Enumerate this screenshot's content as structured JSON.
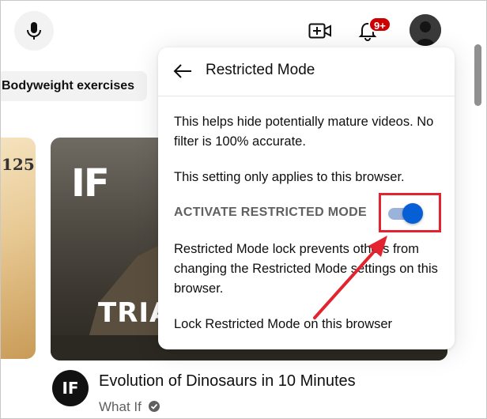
{
  "header": {
    "mic_icon": "microphone-icon",
    "create_icon": "video-create-icon",
    "bell_icon": "bell-icon",
    "notification_count": "9+"
  },
  "chip": {
    "label": "Bodyweight exercises"
  },
  "thumbnails": {
    "left_label": "125",
    "main_logo": "IF",
    "main_overlay": "TRIASS"
  },
  "video": {
    "title": "Evolution of Dinosaurs in 10 Minutes",
    "channel": "What If",
    "channel_avatar_text": "IF"
  },
  "popup": {
    "title": "Restricted Mode",
    "line1": "This helps hide potentially mature videos. No filter is 100% accurate.",
    "line2": "This setting only applies to this browser.",
    "activate_label": "ACTIVATE RESTRICTED MODE",
    "toggle_on": true,
    "lock_desc": "Restricted Mode lock prevents others from changing the Restricted Mode settings on this browser.",
    "lock_link": "Lock Restricted Mode on this browser"
  },
  "colors": {
    "accent": "#065fd4",
    "annotation": "#e3232f",
    "badge": "#cc0000"
  }
}
